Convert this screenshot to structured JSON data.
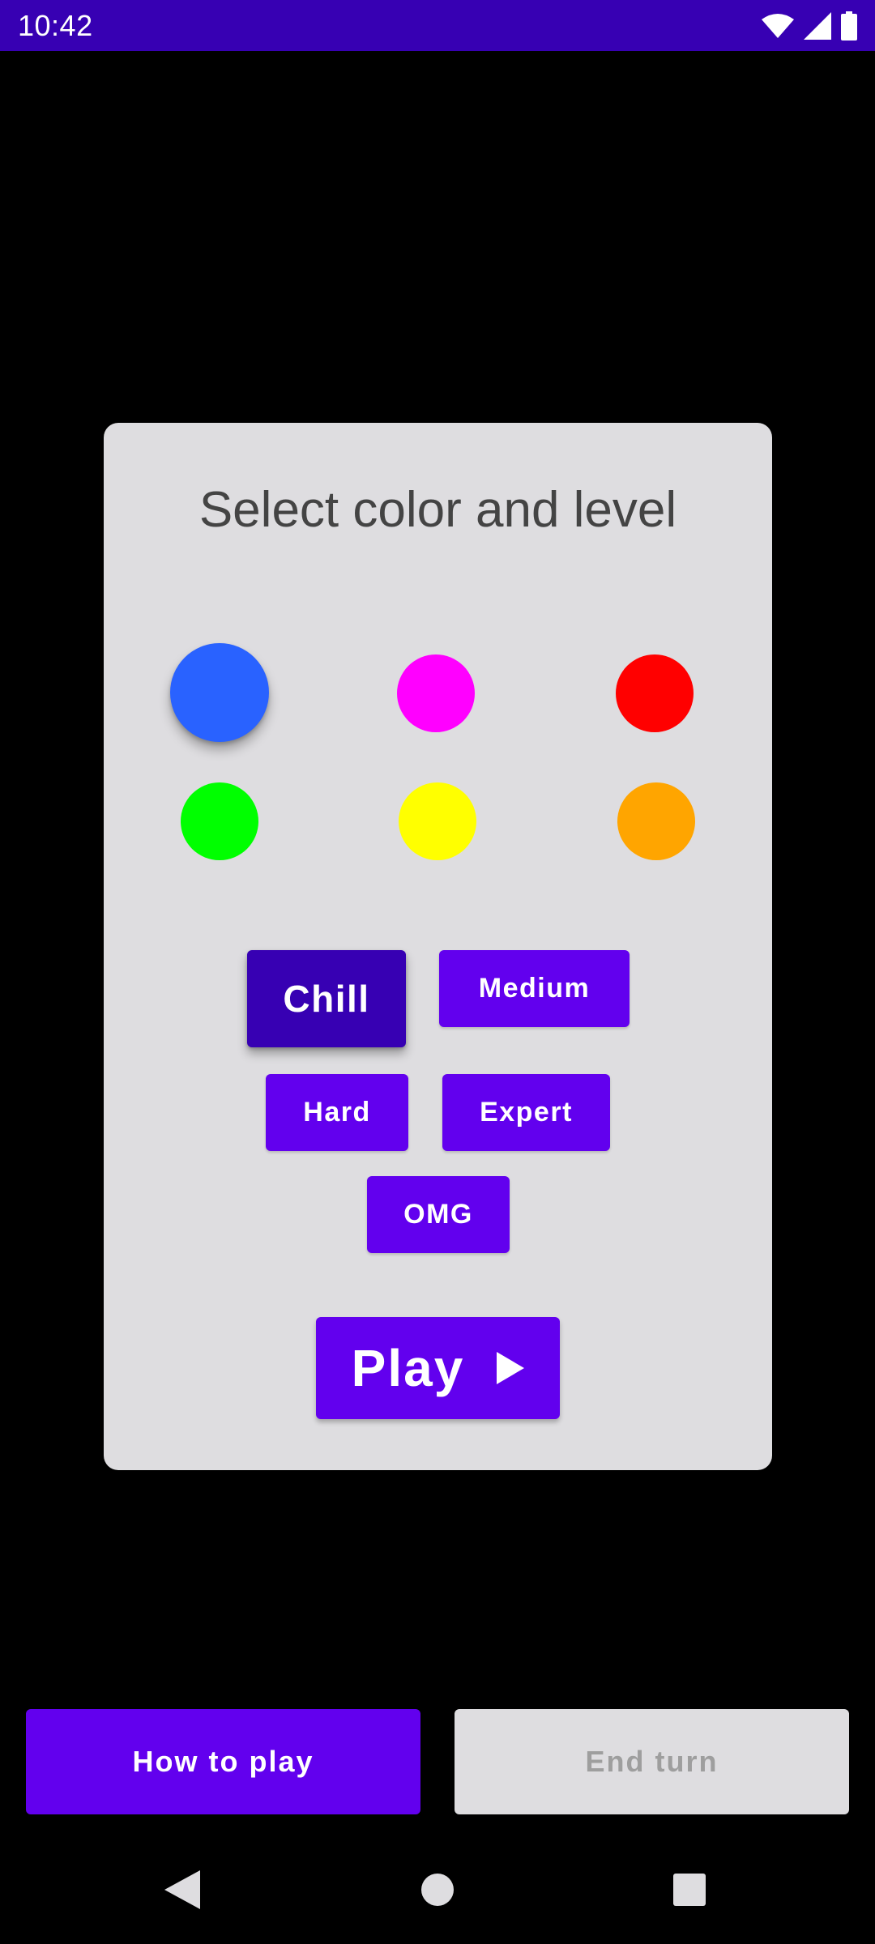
{
  "status_bar": {
    "time": "10:42",
    "icons": [
      "wifi-icon",
      "signal-icon",
      "battery-icon"
    ]
  },
  "dialog": {
    "title": "Select color and level",
    "colors": [
      {
        "name": "blue",
        "hex": "#2962FF",
        "selected": true
      },
      {
        "name": "magenta",
        "hex": "#FF00FF",
        "selected": false
      },
      {
        "name": "red",
        "hex": "#FF0000",
        "selected": false
      },
      {
        "name": "green",
        "hex": "#00FF00",
        "selected": false
      },
      {
        "name": "yellow",
        "hex": "#FFFF00",
        "selected": false
      },
      {
        "name": "orange",
        "hex": "#FFA500",
        "selected": false
      }
    ],
    "levels": [
      {
        "label": "Chill",
        "selected": true
      },
      {
        "label": "Medium",
        "selected": false
      },
      {
        "label": "Hard",
        "selected": false
      },
      {
        "label": "Expert",
        "selected": false
      },
      {
        "label": "OMG",
        "selected": false
      }
    ],
    "play_label": "Play",
    "play_icon": "play-arrow-icon"
  },
  "bottom": {
    "how_to_play_label": "How to play",
    "end_turn_label": "End turn",
    "end_turn_enabled": false
  },
  "nav": {
    "icons": [
      "back-icon",
      "home-icon",
      "recents-icon"
    ]
  },
  "colors": {
    "status_bar_bg": "#3700B3",
    "primary": "#6200EE",
    "primary_dark": "#3700B3",
    "dialog_bg": "#DEDDE0",
    "disabled_text": "#9E9E9E"
  }
}
